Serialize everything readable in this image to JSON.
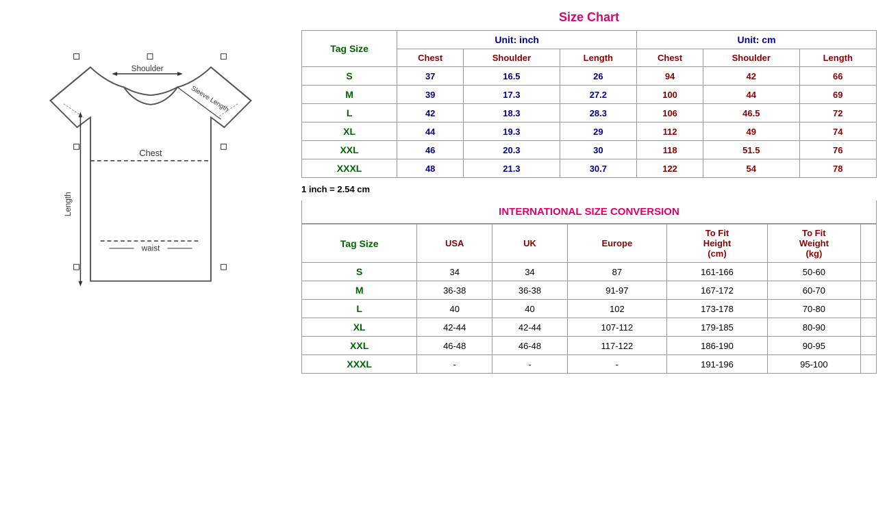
{
  "leftPanel": {
    "imageAlt": "T-shirt size diagram"
  },
  "sizeChart": {
    "title": "Size Chart",
    "unitInch": "Unit: inch",
    "unitCm": "Unit: cm",
    "tagSizeLabel": "Tag Size",
    "headers": {
      "chest": "Chest",
      "shoulder": "Shoulder",
      "length": "Length"
    },
    "rows": [
      {
        "tag": "S",
        "inchChest": "37",
        "inchShoulder": "16.5",
        "inchLength": "26",
        "cmChest": "94",
        "cmShoulder": "42",
        "cmLength": "66"
      },
      {
        "tag": "M",
        "inchChest": "39",
        "inchShoulder": "17.3",
        "inchLength": "27.2",
        "cmChest": "100",
        "cmShoulder": "44",
        "cmLength": "69"
      },
      {
        "tag": "L",
        "inchChest": "42",
        "inchShoulder": "18.3",
        "inchLength": "28.3",
        "cmChest": "106",
        "cmShoulder": "46.5",
        "cmLength": "72"
      },
      {
        "tag": "XL",
        "inchChest": "44",
        "inchShoulder": "19.3",
        "inchLength": "29",
        "cmChest": "112",
        "cmShoulder": "49",
        "cmLength": "74"
      },
      {
        "tag": "XXL",
        "inchChest": "46",
        "inchShoulder": "20.3",
        "inchLength": "30",
        "cmChest": "118",
        "cmShoulder": "51.5",
        "cmLength": "76"
      },
      {
        "tag": "XXXL",
        "inchChest": "48",
        "inchShoulder": "21.3",
        "inchLength": "30.7",
        "cmChest": "122",
        "cmShoulder": "54",
        "cmLength": "78"
      }
    ],
    "inchEquation": "1 inch = 2.54 cm"
  },
  "conversionChart": {
    "title": "INTERNATIONAL SIZE CONVERSION",
    "tagSizeLabel": "Tag Size",
    "headers": {
      "usa": "USA",
      "uk": "UK",
      "europe": "Europe",
      "toFitHeight": "To Fit\nHeight\n(cm)",
      "toFitWeight": "To Fit\nWeight\n(kg)"
    },
    "rows": [
      {
        "tag": "S",
        "usa": "34",
        "uk": "34",
        "europe": "87",
        "height": "161-166",
        "weight": "50-60"
      },
      {
        "tag": "M",
        "usa": "36-38",
        "uk": "36-38",
        "europe": "91-97",
        "height": "167-172",
        "weight": "60-70"
      },
      {
        "tag": "L",
        "usa": "40",
        "uk": "40",
        "europe": "102",
        "height": "173-178",
        "weight": "70-80"
      },
      {
        "tag": "XL",
        "usa": "42-44",
        "uk": "42-44",
        "europe": "107-112",
        "height": "179-185",
        "weight": "80-90"
      },
      {
        "tag": "XXL",
        "usa": "46-48",
        "uk": "46-48",
        "europe": "117-122",
        "height": "186-190",
        "weight": "90-95"
      },
      {
        "tag": "XXXL",
        "usa": "-",
        "uk": "-",
        "europe": "-",
        "height": "191-196",
        "weight": "95-100"
      }
    ]
  }
}
